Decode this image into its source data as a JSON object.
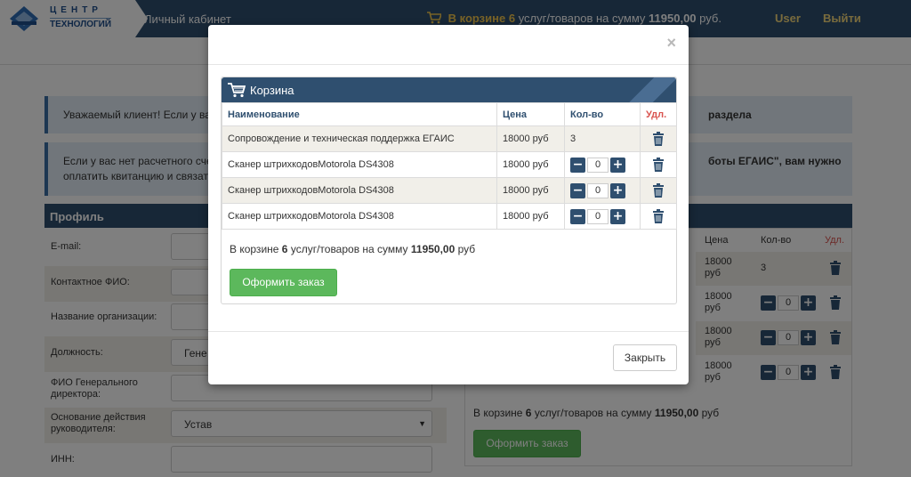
{
  "header": {
    "logo_line1": "ЦЕНТР",
    "logo_line2": "ТЕХНОЛОГИЙ",
    "cabinet_label": "Личный кабинет",
    "cart_prefix": "В корзине",
    "cart_count": "6",
    "cart_middle": "услуг/товаров на сумму",
    "cart_sum": "11950,00",
    "cart_currency": "руб.",
    "user_label": "User",
    "logout_label": "Выйти"
  },
  "background": {
    "alert1_text": "Уважаемый клиент! Если у ва",
    "alert1_right": "раздела",
    "alert2_line1": "Если у вас нет расчетного сче",
    "alert2_line2": "оплатить квитанцию и связать",
    "alert2_right": "боты ЕГАИС\", вам нужно",
    "profile_title": "Профиль",
    "fields": [
      {
        "label": "E-mail:",
        "value": ""
      },
      {
        "label": "Контактное ФИО:",
        "value": ""
      },
      {
        "label": "Название организации:",
        "value": ""
      },
      {
        "label": "Должность:",
        "value": "Гене"
      },
      {
        "label": "ФИО Генерального директора:",
        "value": ""
      },
      {
        "label": "Основание действия руководителя:",
        "value": "Устав"
      },
      {
        "label": "ИНН:",
        "value": ""
      }
    ],
    "table_head": {
      "price": "Цена",
      "qty": "Кол-во",
      "del": "Удл."
    },
    "rows": [
      {
        "price": "18000 руб",
        "qty": "3"
      },
      {
        "price": "18000 руб",
        "qty": "0"
      },
      {
        "price": "18000 руб",
        "qty": "0"
      },
      {
        "price": "18000 руб",
        "qty": "0"
      }
    ],
    "total_prefix": "В корзине",
    "total_count": "6",
    "total_middle": "услуг/товаров на сумму",
    "total_sum": "11950,00",
    "total_currency": "руб",
    "order_button": "Оформить заказ"
  },
  "modal": {
    "close_symbol": "×",
    "cart_title": "Корзина",
    "columns": {
      "name": "Наименование",
      "price": "Цена",
      "qty": "Кол-во",
      "del": "Удл."
    },
    "items": [
      {
        "name": "Сопровождение и техническая поддержка ЕГАИС",
        "price": "18000 руб",
        "qty": "3",
        "editable": false
      },
      {
        "name": "Сканер штрихкодовMotorola DS4308",
        "price": "18000 руб",
        "qty": "0",
        "editable": true
      },
      {
        "name": "Сканер штрихкодовMotorola DS4308",
        "price": "18000 руб",
        "qty": "0",
        "editable": true
      },
      {
        "name": "Сканер штрихкодовMotorola DS4308",
        "price": "18000 руб",
        "qty": "0",
        "editable": true
      }
    ],
    "minus": "−",
    "plus": "+",
    "total_prefix": "В корзине",
    "total_count": "6",
    "total_middle": "услуг/товаров на сумму",
    "total_sum": "11950,00",
    "total_currency": "руб",
    "order_button": "Оформить заказ",
    "close_button": "Закрыть"
  },
  "colors": {
    "header_bg": "#2f4f6f",
    "accent_yellow": "#f3c64d",
    "button_green": "#5cb85c",
    "delete_red": "#d9534f"
  }
}
